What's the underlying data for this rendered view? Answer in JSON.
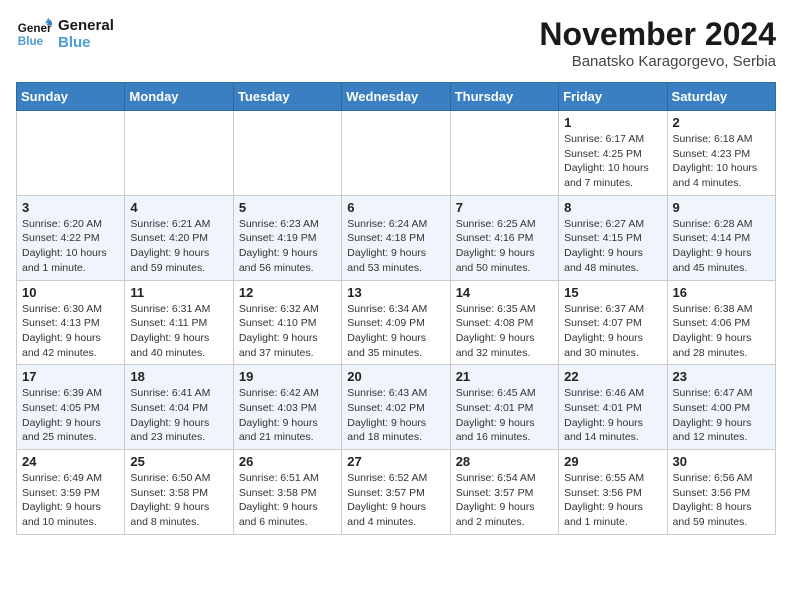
{
  "header": {
    "logo_line1": "General",
    "logo_line2": "Blue",
    "month": "November 2024",
    "location": "Banatsko Karagorgevo, Serbia"
  },
  "weekdays": [
    "Sunday",
    "Monday",
    "Tuesday",
    "Wednesday",
    "Thursday",
    "Friday",
    "Saturday"
  ],
  "weeks": [
    [
      {
        "day": "",
        "info": ""
      },
      {
        "day": "",
        "info": ""
      },
      {
        "day": "",
        "info": ""
      },
      {
        "day": "",
        "info": ""
      },
      {
        "day": "",
        "info": ""
      },
      {
        "day": "1",
        "info": "Sunrise: 6:17 AM\nSunset: 4:25 PM\nDaylight: 10 hours and 7 minutes."
      },
      {
        "day": "2",
        "info": "Sunrise: 6:18 AM\nSunset: 4:23 PM\nDaylight: 10 hours and 4 minutes."
      }
    ],
    [
      {
        "day": "3",
        "info": "Sunrise: 6:20 AM\nSunset: 4:22 PM\nDaylight: 10 hours and 1 minute."
      },
      {
        "day": "4",
        "info": "Sunrise: 6:21 AM\nSunset: 4:20 PM\nDaylight: 9 hours and 59 minutes."
      },
      {
        "day": "5",
        "info": "Sunrise: 6:23 AM\nSunset: 4:19 PM\nDaylight: 9 hours and 56 minutes."
      },
      {
        "day": "6",
        "info": "Sunrise: 6:24 AM\nSunset: 4:18 PM\nDaylight: 9 hours and 53 minutes."
      },
      {
        "day": "7",
        "info": "Sunrise: 6:25 AM\nSunset: 4:16 PM\nDaylight: 9 hours and 50 minutes."
      },
      {
        "day": "8",
        "info": "Sunrise: 6:27 AM\nSunset: 4:15 PM\nDaylight: 9 hours and 48 minutes."
      },
      {
        "day": "9",
        "info": "Sunrise: 6:28 AM\nSunset: 4:14 PM\nDaylight: 9 hours and 45 minutes."
      }
    ],
    [
      {
        "day": "10",
        "info": "Sunrise: 6:30 AM\nSunset: 4:13 PM\nDaylight: 9 hours and 42 minutes."
      },
      {
        "day": "11",
        "info": "Sunrise: 6:31 AM\nSunset: 4:11 PM\nDaylight: 9 hours and 40 minutes."
      },
      {
        "day": "12",
        "info": "Sunrise: 6:32 AM\nSunset: 4:10 PM\nDaylight: 9 hours and 37 minutes."
      },
      {
        "day": "13",
        "info": "Sunrise: 6:34 AM\nSunset: 4:09 PM\nDaylight: 9 hours and 35 minutes."
      },
      {
        "day": "14",
        "info": "Sunrise: 6:35 AM\nSunset: 4:08 PM\nDaylight: 9 hours and 32 minutes."
      },
      {
        "day": "15",
        "info": "Sunrise: 6:37 AM\nSunset: 4:07 PM\nDaylight: 9 hours and 30 minutes."
      },
      {
        "day": "16",
        "info": "Sunrise: 6:38 AM\nSunset: 4:06 PM\nDaylight: 9 hours and 28 minutes."
      }
    ],
    [
      {
        "day": "17",
        "info": "Sunrise: 6:39 AM\nSunset: 4:05 PM\nDaylight: 9 hours and 25 minutes."
      },
      {
        "day": "18",
        "info": "Sunrise: 6:41 AM\nSunset: 4:04 PM\nDaylight: 9 hours and 23 minutes."
      },
      {
        "day": "19",
        "info": "Sunrise: 6:42 AM\nSunset: 4:03 PM\nDaylight: 9 hours and 21 minutes."
      },
      {
        "day": "20",
        "info": "Sunrise: 6:43 AM\nSunset: 4:02 PM\nDaylight: 9 hours and 18 minutes."
      },
      {
        "day": "21",
        "info": "Sunrise: 6:45 AM\nSunset: 4:01 PM\nDaylight: 9 hours and 16 minutes."
      },
      {
        "day": "22",
        "info": "Sunrise: 6:46 AM\nSunset: 4:01 PM\nDaylight: 9 hours and 14 minutes."
      },
      {
        "day": "23",
        "info": "Sunrise: 6:47 AM\nSunset: 4:00 PM\nDaylight: 9 hours and 12 minutes."
      }
    ],
    [
      {
        "day": "24",
        "info": "Sunrise: 6:49 AM\nSunset: 3:59 PM\nDaylight: 9 hours and 10 minutes."
      },
      {
        "day": "25",
        "info": "Sunrise: 6:50 AM\nSunset: 3:58 PM\nDaylight: 9 hours and 8 minutes."
      },
      {
        "day": "26",
        "info": "Sunrise: 6:51 AM\nSunset: 3:58 PM\nDaylight: 9 hours and 6 minutes."
      },
      {
        "day": "27",
        "info": "Sunrise: 6:52 AM\nSunset: 3:57 PM\nDaylight: 9 hours and 4 minutes."
      },
      {
        "day": "28",
        "info": "Sunrise: 6:54 AM\nSunset: 3:57 PM\nDaylight: 9 hours and 2 minutes."
      },
      {
        "day": "29",
        "info": "Sunrise: 6:55 AM\nSunset: 3:56 PM\nDaylight: 9 hours and 1 minute."
      },
      {
        "day": "30",
        "info": "Sunrise: 6:56 AM\nSunset: 3:56 PM\nDaylight: 8 hours and 59 minutes."
      }
    ]
  ]
}
